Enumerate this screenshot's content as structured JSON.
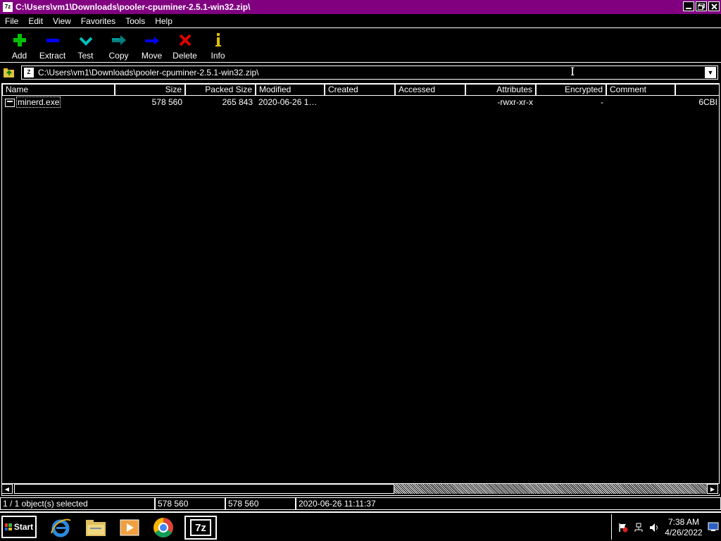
{
  "window": {
    "title": "C:\\Users\\vm1\\Downloads\\pooler-cpuminer-2.5.1-win32.zip\\",
    "app_icon_text": "7z"
  },
  "menu": {
    "items": [
      "File",
      "Edit",
      "View",
      "Favorites",
      "Tools",
      "Help"
    ]
  },
  "toolbar": {
    "buttons": [
      {
        "label": "Add",
        "icon": "plus-icon",
        "color": "#00c000"
      },
      {
        "label": "Extract",
        "icon": "minus-icon",
        "color": "#0000ff"
      },
      {
        "label": "Test",
        "icon": "check-chevron-icon",
        "color": "#00c0c0"
      },
      {
        "label": "Copy",
        "icon": "arrow-right-copy-icon",
        "color": "#008080"
      },
      {
        "label": "Move",
        "icon": "arrow-right-move-icon",
        "color": "#0000ff"
      },
      {
        "label": "Delete",
        "icon": "x-icon",
        "color": "#e00000"
      },
      {
        "label": "Info",
        "icon": "info-icon",
        "color": "#e0c000"
      }
    ]
  },
  "address": {
    "path": "C:\\Users\\vm1\\Downloads\\pooler-cpuminer-2.5.1-win32.zip\\"
  },
  "columns": [
    "Name",
    "Size",
    "Packed Size",
    "Modified",
    "Created",
    "Accessed",
    "Attributes",
    "Encrypted",
    "Comment"
  ],
  "rows": [
    {
      "name": "minerd.exe",
      "size": "578 560",
      "packed_size": "265 843",
      "modified": "2020-06-26 1…",
      "created": "",
      "accessed": "",
      "attributes": "-rwxr-xr-x",
      "encrypted": "-",
      "comment": "",
      "crc": "6CBI"
    }
  ],
  "status": {
    "selection": "1 / 1 object(s) selected",
    "size": "578 560",
    "packed": "578 560",
    "modified": "2020-06-26 11:11:37"
  },
  "taskbar": {
    "start_label": "Start",
    "pinned": [
      "internet-explorer-icon",
      "file-explorer-icon",
      "media-player-icon",
      "chrome-icon",
      "7zip-icon"
    ],
    "active_app_label": "7z",
    "clock_time": "7:38 AM",
    "clock_date": "4/26/2022"
  }
}
